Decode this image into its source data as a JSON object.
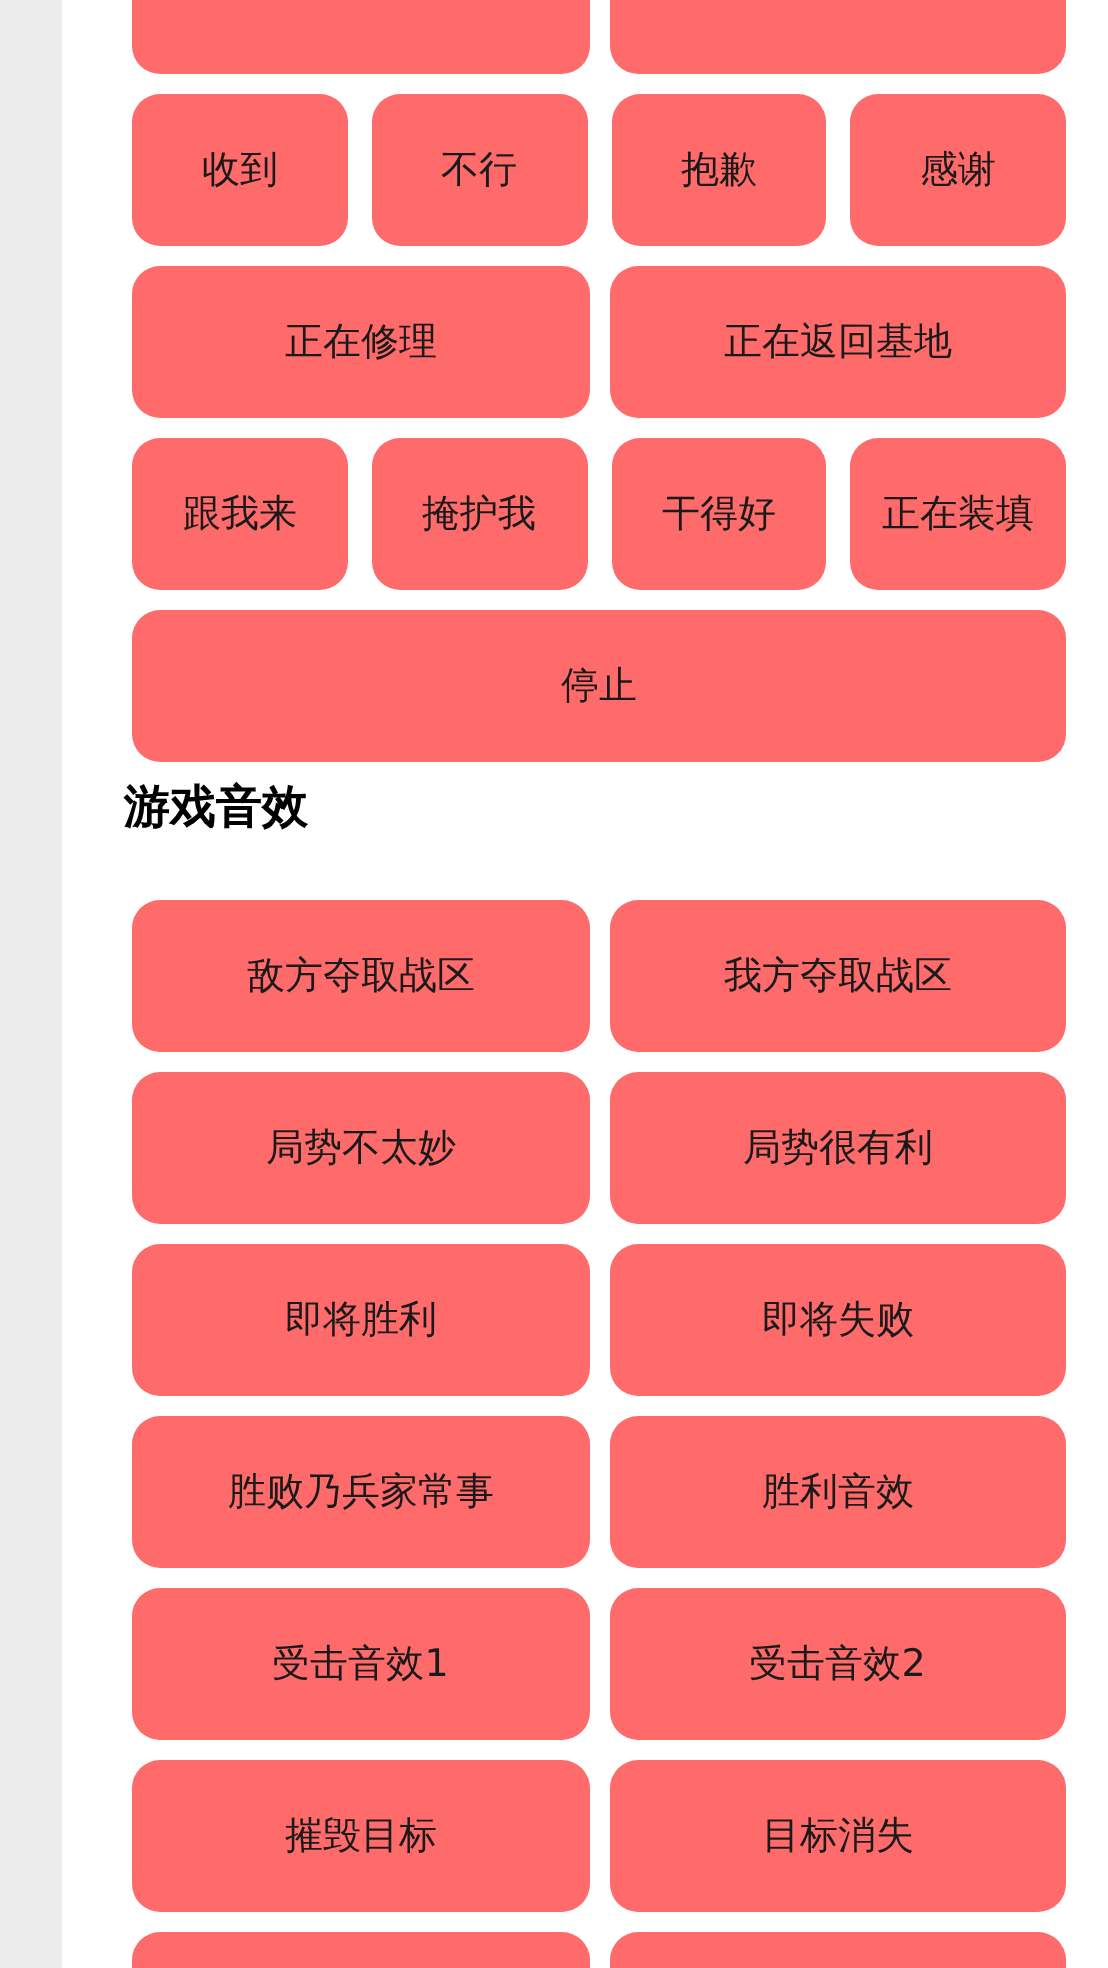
{
  "sections": [
    {
      "rows": [
        {
          "kind": "cut-pair"
        },
        {
          "items": [
            {
              "label": "收到"
            },
            {
              "label": "不行"
            },
            {
              "label": "抱歉"
            },
            {
              "label": "感谢"
            }
          ]
        },
        {
          "items": [
            {
              "label": "正在修理"
            },
            {
              "label": "正在返回基地"
            }
          ]
        },
        {
          "items": [
            {
              "label": "跟我来"
            },
            {
              "label": "掩护我"
            },
            {
              "label": "干得好"
            },
            {
              "label": "正在装填"
            }
          ]
        },
        {
          "items": [
            {
              "label": "停止"
            }
          ]
        }
      ]
    },
    {
      "title": "游戏音效",
      "rows": [
        {
          "items": [
            {
              "label": "敌方夺取战区"
            },
            {
              "label": "我方夺取战区"
            }
          ]
        },
        {
          "items": [
            {
              "label": "局势不太妙"
            },
            {
              "label": "局势很有利"
            }
          ]
        },
        {
          "items": [
            {
              "label": "即将胜利"
            },
            {
              "label": "即将失败"
            }
          ]
        },
        {
          "items": [
            {
              "label": "胜败乃兵家常事"
            },
            {
              "label": "胜利音效"
            }
          ]
        },
        {
          "items": [
            {
              "label": "受击音效1"
            },
            {
              "label": "受击音效2"
            }
          ]
        },
        {
          "items": [
            {
              "label": "摧毁目标"
            },
            {
              "label": "目标消失"
            }
          ]
        },
        {
          "kind": "cut-pair"
        }
      ]
    }
  ]
}
